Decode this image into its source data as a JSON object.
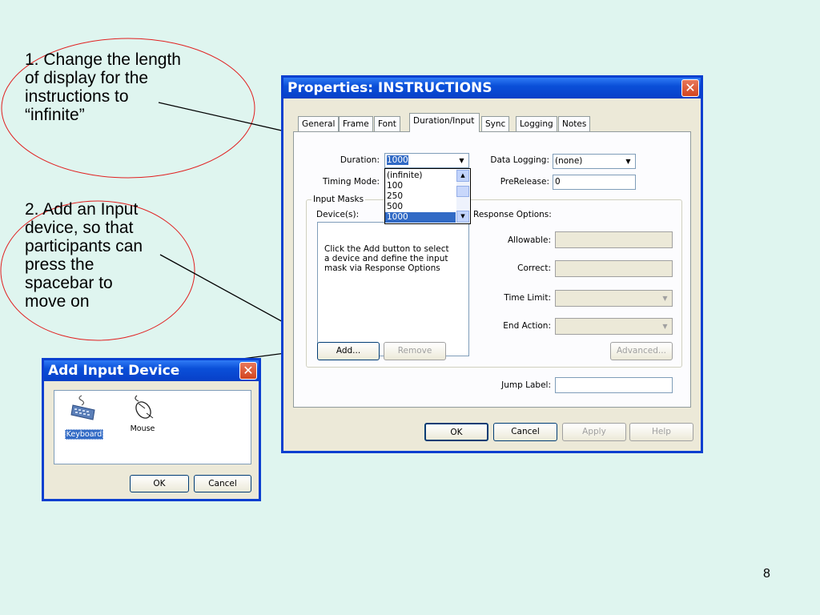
{
  "annotations": {
    "note1": "1. Change the length\nof display for the\ninstructions to\n“infinite”",
    "note2": "2. Add an Input\ndevice, so that\nparticipants can\npress the\nspacebar to\nmove on"
  },
  "page_number": "8",
  "properties_dialog": {
    "title": "Properties: INSTRUCTIONS",
    "tabs": [
      "General",
      "Frame",
      "Font",
      "Duration/Input",
      "Sync",
      "Logging",
      "Notes"
    ],
    "active_tab": "Duration/Input",
    "duration_label": "Duration:",
    "duration_value": "1000",
    "duration_options": [
      "(infinite)",
      "100",
      "250",
      "500",
      "1000"
    ],
    "timing_mode_label": "Timing Mode:",
    "data_logging_label": "Data Logging:",
    "data_logging_value": "(none)",
    "prerelease_label": "PreRelease:",
    "prerelease_value": "0",
    "input_masks_label": "Input Masks",
    "devices_label": "Device(s):",
    "devices_hint": "Click the Add button to select a device and define the input mask via Response Options",
    "response_options_label": "Response Options:",
    "allowable_label": "Allowable:",
    "correct_label": "Correct:",
    "time_limit_label": "Time Limit:",
    "end_action_label": "End Action:",
    "add_button": "Add...",
    "remove_button": "Remove",
    "advanced_button": "Advanced...",
    "jump_label": "Jump Label:",
    "ok_button": "OK",
    "cancel_button": "Cancel",
    "apply_button": "Apply",
    "help_button": "Help"
  },
  "add_input_dialog": {
    "title": "Add Input Device",
    "devices": [
      "Keyboard",
      "Mouse"
    ],
    "ok_button": "OK",
    "cancel_button": "Cancel"
  },
  "colors": {
    "background": "#dff5ef",
    "titlebar": "#0a4fd8",
    "annotation_ellipse": "#e02020",
    "selection": "#316ac5"
  }
}
